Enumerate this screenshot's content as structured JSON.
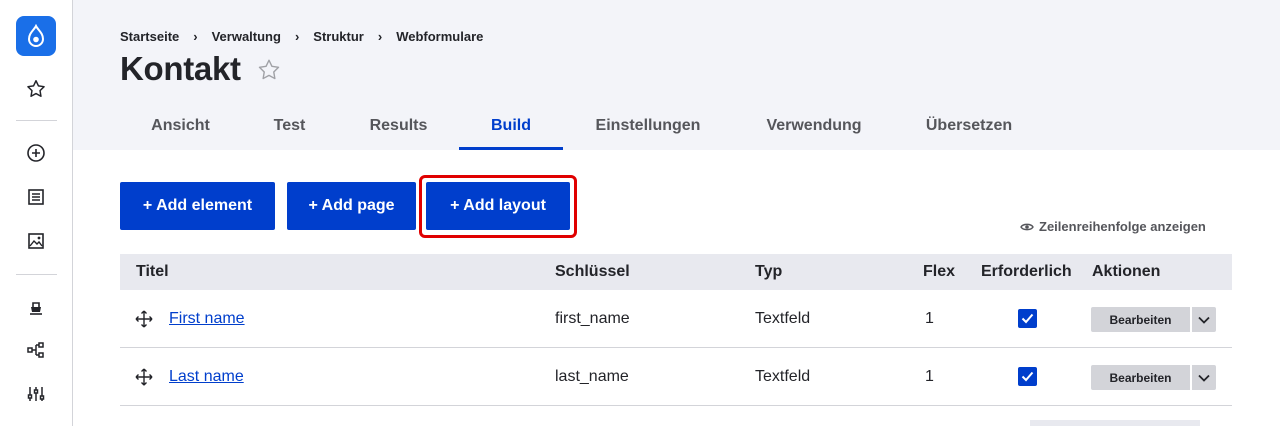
{
  "breadcrumb": [
    "Startseite",
    "Verwaltung",
    "Struktur",
    "Webformulare"
  ],
  "page": {
    "title": "Kontakt"
  },
  "tabs": [
    {
      "label": "Ansicht",
      "active": false
    },
    {
      "label": "Test",
      "active": false
    },
    {
      "label": "Results",
      "active": false
    },
    {
      "label": "Build",
      "active": true
    },
    {
      "label": "Einstellungen",
      "active": false
    },
    {
      "label": "Verwendung",
      "active": false
    },
    {
      "label": "Übersetzen",
      "active": false
    }
  ],
  "actions": {
    "add_element": "+ Add element",
    "add_page": "+ Add page",
    "add_layout": "+ Add layout",
    "row_order": "Zeilenreihenfolge anzeigen"
  },
  "table": {
    "headers": [
      "Titel",
      "Schlüssel",
      "Typ",
      "Flex",
      "Erforderlich",
      "Aktionen"
    ],
    "rows": [
      {
        "title": "First name",
        "key": "first_name",
        "type": "Textfeld",
        "flex": "1",
        "required": true,
        "action": "Bearbeiten"
      },
      {
        "title": "Last name",
        "key": "last_name",
        "type": "Textfeld",
        "flex": "1",
        "required": true,
        "action": "Bearbeiten"
      }
    ]
  },
  "toolbar_icons": [
    "drupal-logo-icon",
    "star-icon",
    "plus-circle-icon",
    "content-icon",
    "media-icon",
    "structure-icon",
    "workflow-icon",
    "config-icon"
  ],
  "colors": {
    "accent": "#003ecc",
    "logo": "#1a6fe8",
    "highlight": "#e00000",
    "header_bg": "#f3f4f9"
  }
}
